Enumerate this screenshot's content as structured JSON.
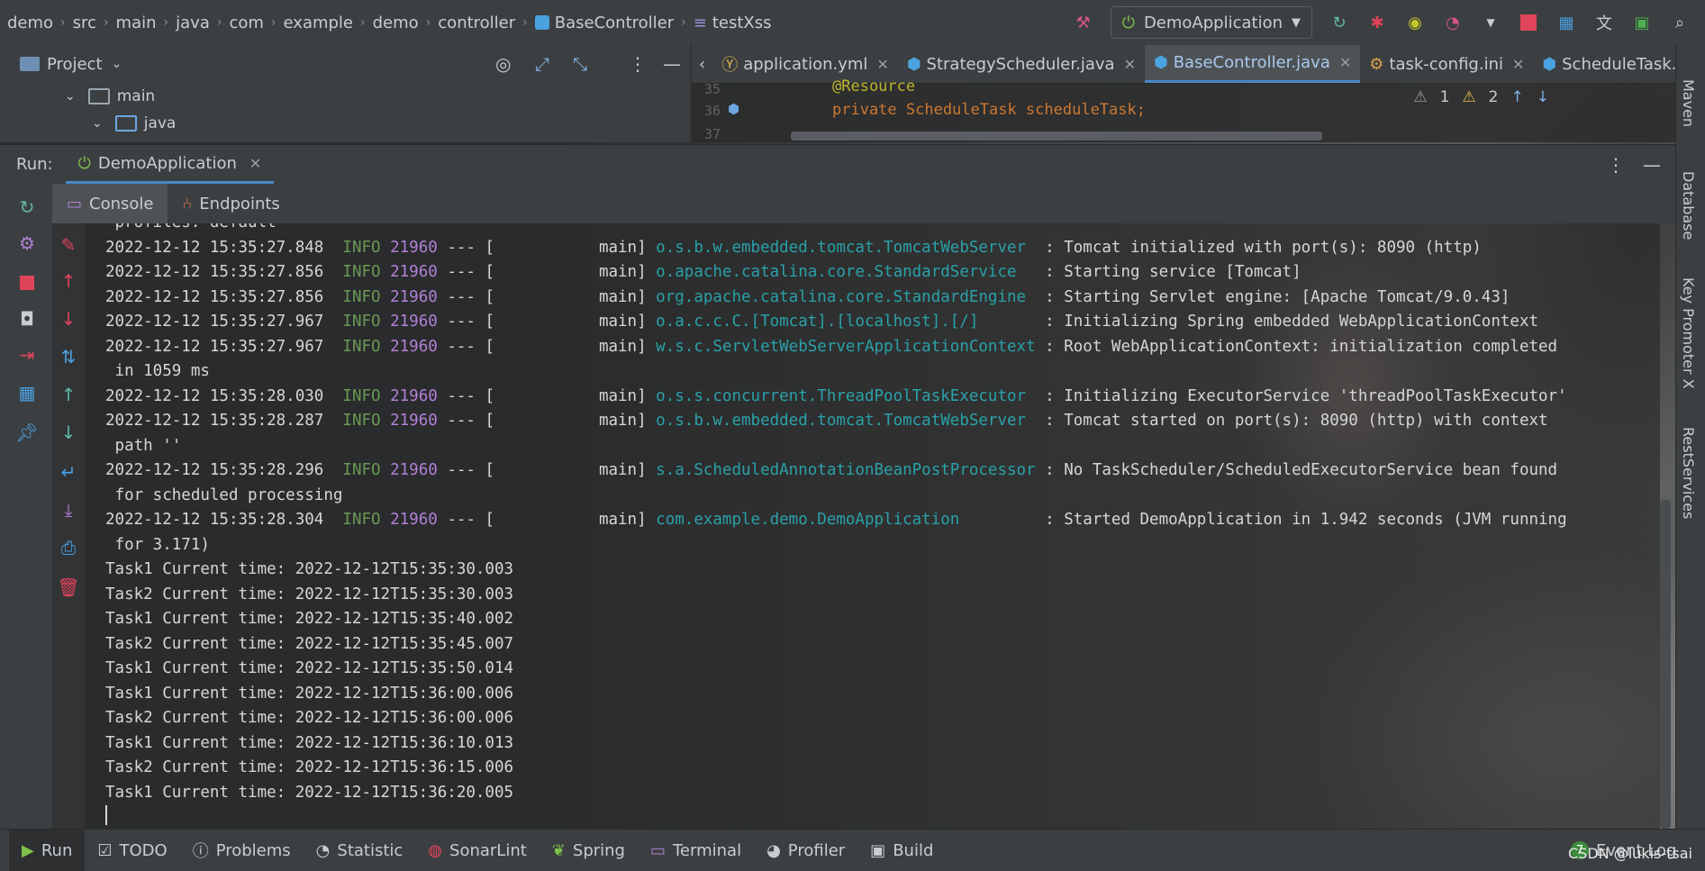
{
  "breadcrumb": [
    "demo",
    "src",
    "main",
    "java",
    "com",
    "example",
    "demo",
    "controller",
    "BaseController",
    "testXss"
  ],
  "run_config": {
    "name": "DemoApplication"
  },
  "project_panel": {
    "title": "Project",
    "tree": [
      {
        "label": "main",
        "color": "#9aa7b0"
      },
      {
        "label": "java",
        "color": "#6da7e3"
      }
    ]
  },
  "editor_tabs": [
    {
      "label": "application.yml"
    },
    {
      "label": "StrategyScheduler.java"
    },
    {
      "label": "BaseController.java",
      "active": true
    },
    {
      "label": "task-config.ini"
    },
    {
      "label": "ScheduleTask.java"
    }
  ],
  "editor": {
    "line_numbers": [
      "35",
      "36",
      "37"
    ],
    "lines": [
      "@Resource",
      "private ScheduleTask scheduleTask;"
    ],
    "warnings": "1",
    "weak_warnings": "2"
  },
  "right_bar": [
    "Maven",
    "Database",
    "Key Promoter X",
    "RestServices"
  ],
  "run_panel": {
    "label": "Run:",
    "tab": "DemoApplication",
    "sub_tabs": [
      "Console",
      "Endpoints"
    ]
  },
  "console": {
    "truncated_first_line": " profiles: default",
    "log_lines": [
      {
        "ts": "2022-12-12 15:35:27.848",
        "level": "INFO",
        "pid": "21960",
        "sep": "--- [",
        "thread": "main]",
        "logger": "o.s.b.w.embedded.tomcat.TomcatWebServer ",
        "msg": ": Tomcat initialized with port(s): 8090 (http)",
        "cont": ""
      },
      {
        "ts": "2022-12-12 15:35:27.856",
        "level": "INFO",
        "pid": "21960",
        "sep": "--- [",
        "thread": "main]",
        "logger": "o.apache.catalina.core.StandardService  ",
        "msg": ": Starting service [Tomcat]",
        "cont": ""
      },
      {
        "ts": "2022-12-12 15:35:27.856",
        "level": "INFO",
        "pid": "21960",
        "sep": "--- [",
        "thread": "main]",
        "logger": "org.apache.catalina.core.StandardEngine ",
        "msg": ": Starting Servlet engine: [Apache Tomcat/9.0.43]",
        "cont": ""
      },
      {
        "ts": "2022-12-12 15:35:27.967",
        "level": "INFO",
        "pid": "21960",
        "sep": "--- [",
        "thread": "main]",
        "logger": "o.a.c.c.C.[Tomcat].[localhost].[/]      ",
        "msg": ": Initializing Spring embedded WebApplicationContext",
        "cont": ""
      },
      {
        "ts": "2022-12-12 15:35:27.967",
        "level": "INFO",
        "pid": "21960",
        "sep": "--- [",
        "thread": "main]",
        "logger": "w.s.c.ServletWebServerApplicationContext",
        "msg": ": Root WebApplicationContext: initialization completed",
        "cont": " in 1059 ms"
      },
      {
        "ts": "2022-12-12 15:35:28.030",
        "level": "INFO",
        "pid": "21960",
        "sep": "--- [",
        "thread": "main]",
        "logger": "o.s.s.concurrent.ThreadPoolTaskExecutor ",
        "msg": ": Initializing ExecutorService 'threadPoolTaskExecutor'",
        "cont": ""
      },
      {
        "ts": "2022-12-12 15:35:28.287",
        "level": "INFO",
        "pid": "21960",
        "sep": "--- [",
        "thread": "main]",
        "logger": "o.s.b.w.embedded.tomcat.TomcatWebServer ",
        "msg": ": Tomcat started on port(s): 8090 (http) with context",
        "cont": " path ''"
      },
      {
        "ts": "2022-12-12 15:35:28.296",
        "level": "INFO",
        "pid": "21960",
        "sep": "--- [",
        "thread": "main]",
        "logger": "s.a.ScheduledAnnotationBeanPostProcessor",
        "msg": ": No TaskScheduler/ScheduledExecutorService bean found",
        "cont": " for scheduled processing"
      },
      {
        "ts": "2022-12-12 15:35:28.304",
        "level": "INFO",
        "pid": "21960",
        "sep": "--- [",
        "thread": "main]",
        "logger": "com.example.demo.DemoApplication        ",
        "msg": ": Started DemoApplication in 1.942 seconds (JVM running",
        "cont": " for 3.171)"
      }
    ],
    "task_lines": [
      "Task1 Current time: 2022-12-12T15:35:30.003",
      "Task2 Current time: 2022-12-12T15:35:30.003",
      "Task1 Current time: 2022-12-12T15:35:40.002",
      "Task2 Current time: 2022-12-12T15:35:45.007",
      "Task1 Current time: 2022-12-12T15:35:50.014",
      "Task1 Current time: 2022-12-12T15:36:00.006",
      "Task2 Current time: 2022-12-12T15:36:00.006",
      "Task1 Current time: 2022-12-12T15:36:10.013",
      "Task2 Current time: 2022-12-12T15:36:15.006",
      "Task1 Current time: 2022-12-12T15:36:20.005"
    ]
  },
  "status_bar": {
    "items": [
      "Run",
      "TODO",
      "Problems",
      "Statistic",
      "SonarLint",
      "Spring",
      "Terminal",
      "Profiler",
      "Build"
    ],
    "event_log": "Event Log",
    "event_count": "7",
    "watermark": "CSDN @lukis-tsai"
  },
  "colors": {
    "info": "#6a9955",
    "pid": "#b180d7",
    "logger": "#2aa1a8",
    "accent": "#4a88c7"
  }
}
